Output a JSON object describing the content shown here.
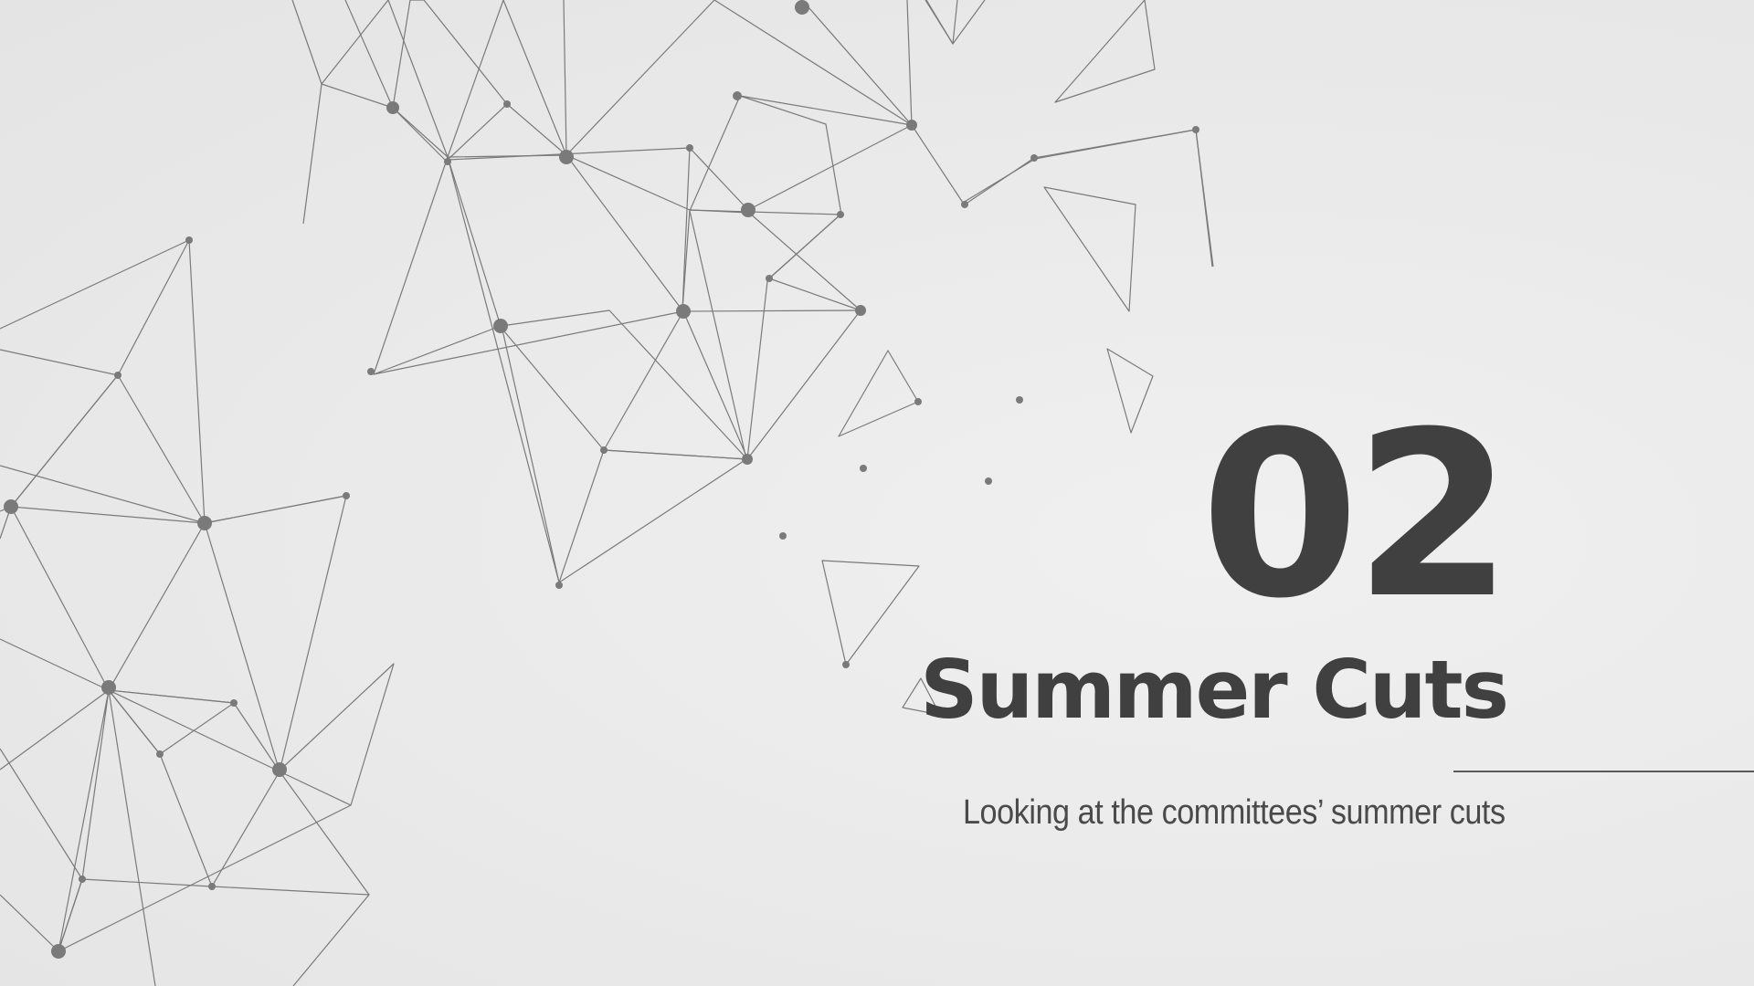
{
  "slide": {
    "number": "02",
    "title": "Summer Cuts",
    "subtitle": "Looking at the committees’ summer cuts"
  },
  "colors": {
    "background": "#ebebeb",
    "text": "#404040",
    "network": "#7a7a7a"
  }
}
